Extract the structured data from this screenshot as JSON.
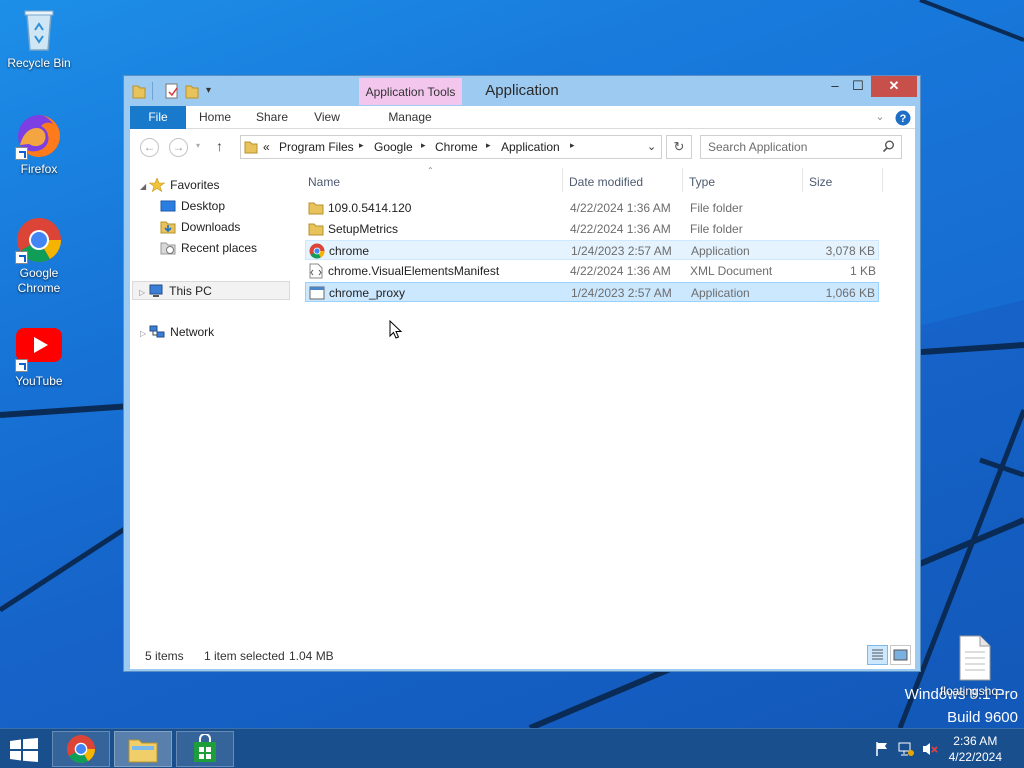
{
  "desktop": {
    "icons": [
      {
        "label": "Recycle Bin"
      },
      {
        "label": "Firefox"
      },
      {
        "label": "Google Chrome"
      },
      {
        "label": "YouTube"
      },
      {
        "label": "floatingsho..."
      }
    ],
    "watermark_line1": "Windows 8.1 Pro",
    "watermark_line2": "Build 9600"
  },
  "window": {
    "title": "Application",
    "contextual_tab": "Application Tools",
    "controls": {
      "minimize": "–",
      "maximize": "☐",
      "close": "✕"
    },
    "ribbon_tabs": [
      "File",
      "Home",
      "Share",
      "View",
      "Manage"
    ],
    "address": {
      "prefix": "«",
      "breadcrumbs": [
        "Program Files",
        "Google",
        "Chrome",
        "Application"
      ]
    },
    "search": {
      "placeholder": "Search Application"
    },
    "nav_pane": {
      "favorites": "Favorites",
      "favorite_items": [
        "Desktop",
        "Downloads",
        "Recent places"
      ],
      "this_pc": "This PC",
      "network": "Network"
    },
    "columns": [
      "Name",
      "Date modified",
      "Type",
      "Size"
    ],
    "files": [
      {
        "name": "109.0.5414.120",
        "date": "4/22/2024 1:36 AM",
        "type": "File folder",
        "size": "",
        "icon": "folder-icon"
      },
      {
        "name": "SetupMetrics",
        "date": "4/22/2024 1:36 AM",
        "type": "File folder",
        "size": "",
        "icon": "folder-icon"
      },
      {
        "name": "chrome",
        "date": "1/24/2023 2:57 AM",
        "type": "Application",
        "size": "3,078 KB",
        "icon": "chrome-icon"
      },
      {
        "name": "chrome.VisualElementsManifest",
        "date": "4/22/2024 1:36 AM",
        "type": "XML Document",
        "size": "1 KB",
        "icon": "xml-file-icon"
      },
      {
        "name": "chrome_proxy",
        "date": "1/24/2023 2:57 AM",
        "type": "Application",
        "size": "1,066 KB",
        "icon": "application-icon"
      }
    ],
    "status": {
      "items": "5 items",
      "selected": "1 item selected",
      "size": "1.04 MB"
    }
  },
  "taskbar": {
    "time": "2:36 AM",
    "date": "4/22/2024"
  },
  "colors": {
    "accent": "#1979ca",
    "selection": "#cce8ff",
    "taskbar": "#1a4f8e",
    "tools_tab": "#f3c6ee"
  }
}
